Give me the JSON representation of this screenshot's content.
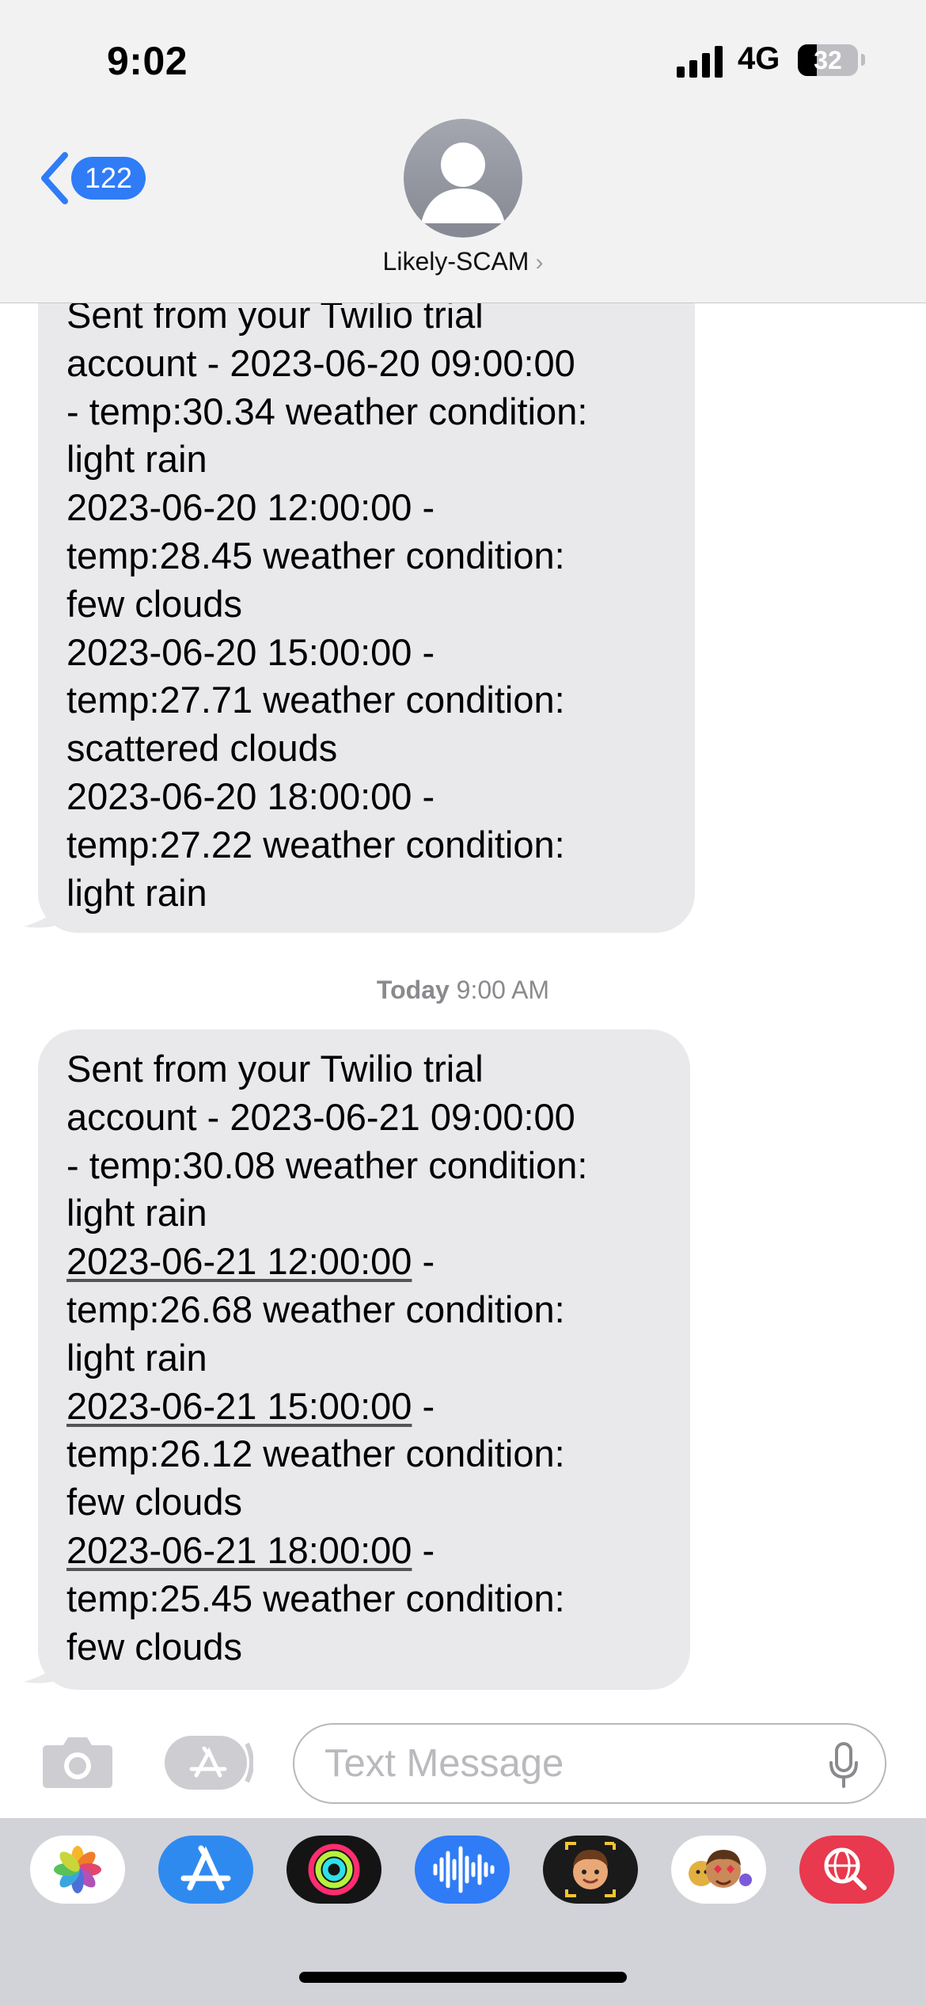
{
  "status_bar": {
    "time": "9:02",
    "network": "4G",
    "battery": "32",
    "battery_level": 0.32
  },
  "nav": {
    "back_count": "122",
    "contact_name": "Likely-SCAM",
    "contact_chevron": "›"
  },
  "conversation": {
    "messages": [
      {
        "lines": [
          "Sent from your Twilio trial",
          "account - 2023-06-20 09:00:00",
          "- temp:30.34 weather condition:",
          "light rain",
          "2023-06-20 12:00:00 -",
          "temp:28.45 weather condition:",
          "few clouds",
          "2023-06-20 15:00:00 -",
          "temp:27.71 weather condition:",
          "scattered clouds",
          "2023-06-20 18:00:00 -",
          "temp:27.22 weather condition:",
          "light rain"
        ]
      },
      {
        "lines": [
          "Sent from your Twilio trial",
          "account - 2023-06-21 09:00:00",
          "- temp:30.08 weather condition:",
          "light rain"
        ],
        "groups": [
          {
            "date_link": "2023-06-21 12:00:00",
            "suffix": " -",
            "temp_line": "temp:26.68 weather condition:",
            "condition": "light rain"
          },
          {
            "date_link": "2023-06-21 15:00:00",
            "suffix": " -",
            "temp_line": "temp:26.12 weather condition:",
            "condition": "few clouds"
          },
          {
            "date_link": "2023-06-21 18:00:00",
            "suffix": " -",
            "temp_line": "temp:25.45 weather condition:",
            "condition": "few clouds"
          }
        ]
      }
    ],
    "timestamp_day": "Today",
    "timestamp_time": "9:00 AM"
  },
  "input_bar": {
    "placeholder": "Text Message",
    "icons": [
      "camera-icon",
      "app-store-icon",
      "microphone-icon"
    ]
  },
  "app_drawer": {
    "apps": [
      "photos-app-icon",
      "app-store-app-icon",
      "fitness-app-icon",
      "audio-message-app-icon",
      "memoji-app-icon",
      "memoji-stickers-app-icon",
      "web-search-app-icon"
    ]
  },
  "colors": {
    "accent": "#2f7cf6",
    "bubble_gray": "#e9e9eb",
    "header_bg": "#f2f2f3",
    "drawer_bg": "#d2d3d9"
  }
}
